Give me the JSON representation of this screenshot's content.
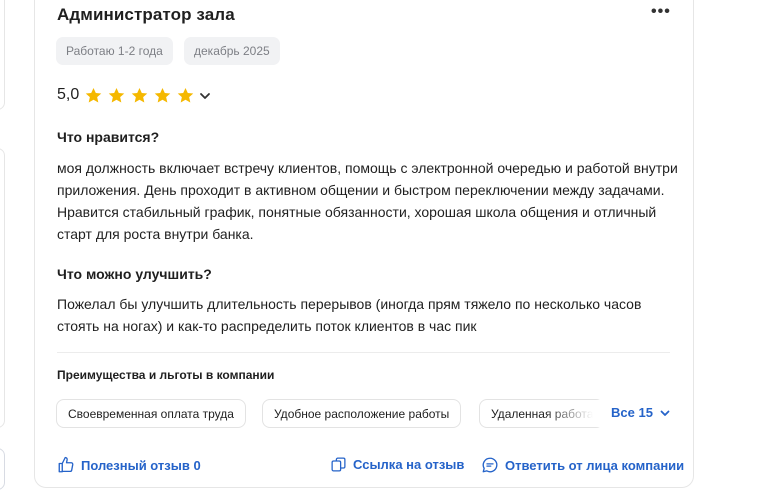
{
  "review": {
    "title": "Администратор зала",
    "tags": [
      "Работаю 1-2 года",
      "декабрь 2025"
    ],
    "rating": "5,0",
    "stars": 5,
    "likes_label": "Что нравится?",
    "likes_text": "моя должность включает встречу клиентов, помощь с электронной очередью и работой внутри приложения. День проходит в активном общении и быстром переключении между задачами. Нравится стабильный график, понятные обязанности, хорошая школа общения и отличный старт для роста внутри банка.",
    "improve_label": "Что можно улучшить?",
    "improve_text": "Пожелал бы улучшить длительность перерывов (иногда прям тяжело по несколько часов стоять на ногах) и как-то распределить поток клиентов в час пик"
  },
  "benefits": {
    "title": "Преимущества и льготы в компании",
    "items": [
      "Своевременная оплата труда",
      "Удобное расположение работы",
      "Удаленная работа"
    ],
    "all_label": "Все 15"
  },
  "actions": {
    "helpful": "Полезный отзыв 0",
    "link": "Ссылка на отзыв",
    "reply": "Ответить от лица компании"
  },
  "colors": {
    "accent": "#2563c9",
    "star": "#f5b800",
    "tag_bg": "#f1f2f4"
  },
  "icons": [
    "more-icon",
    "star-icon",
    "chevron-down-icon",
    "thumbs-up-icon",
    "link-icon",
    "chat-icon"
  ]
}
